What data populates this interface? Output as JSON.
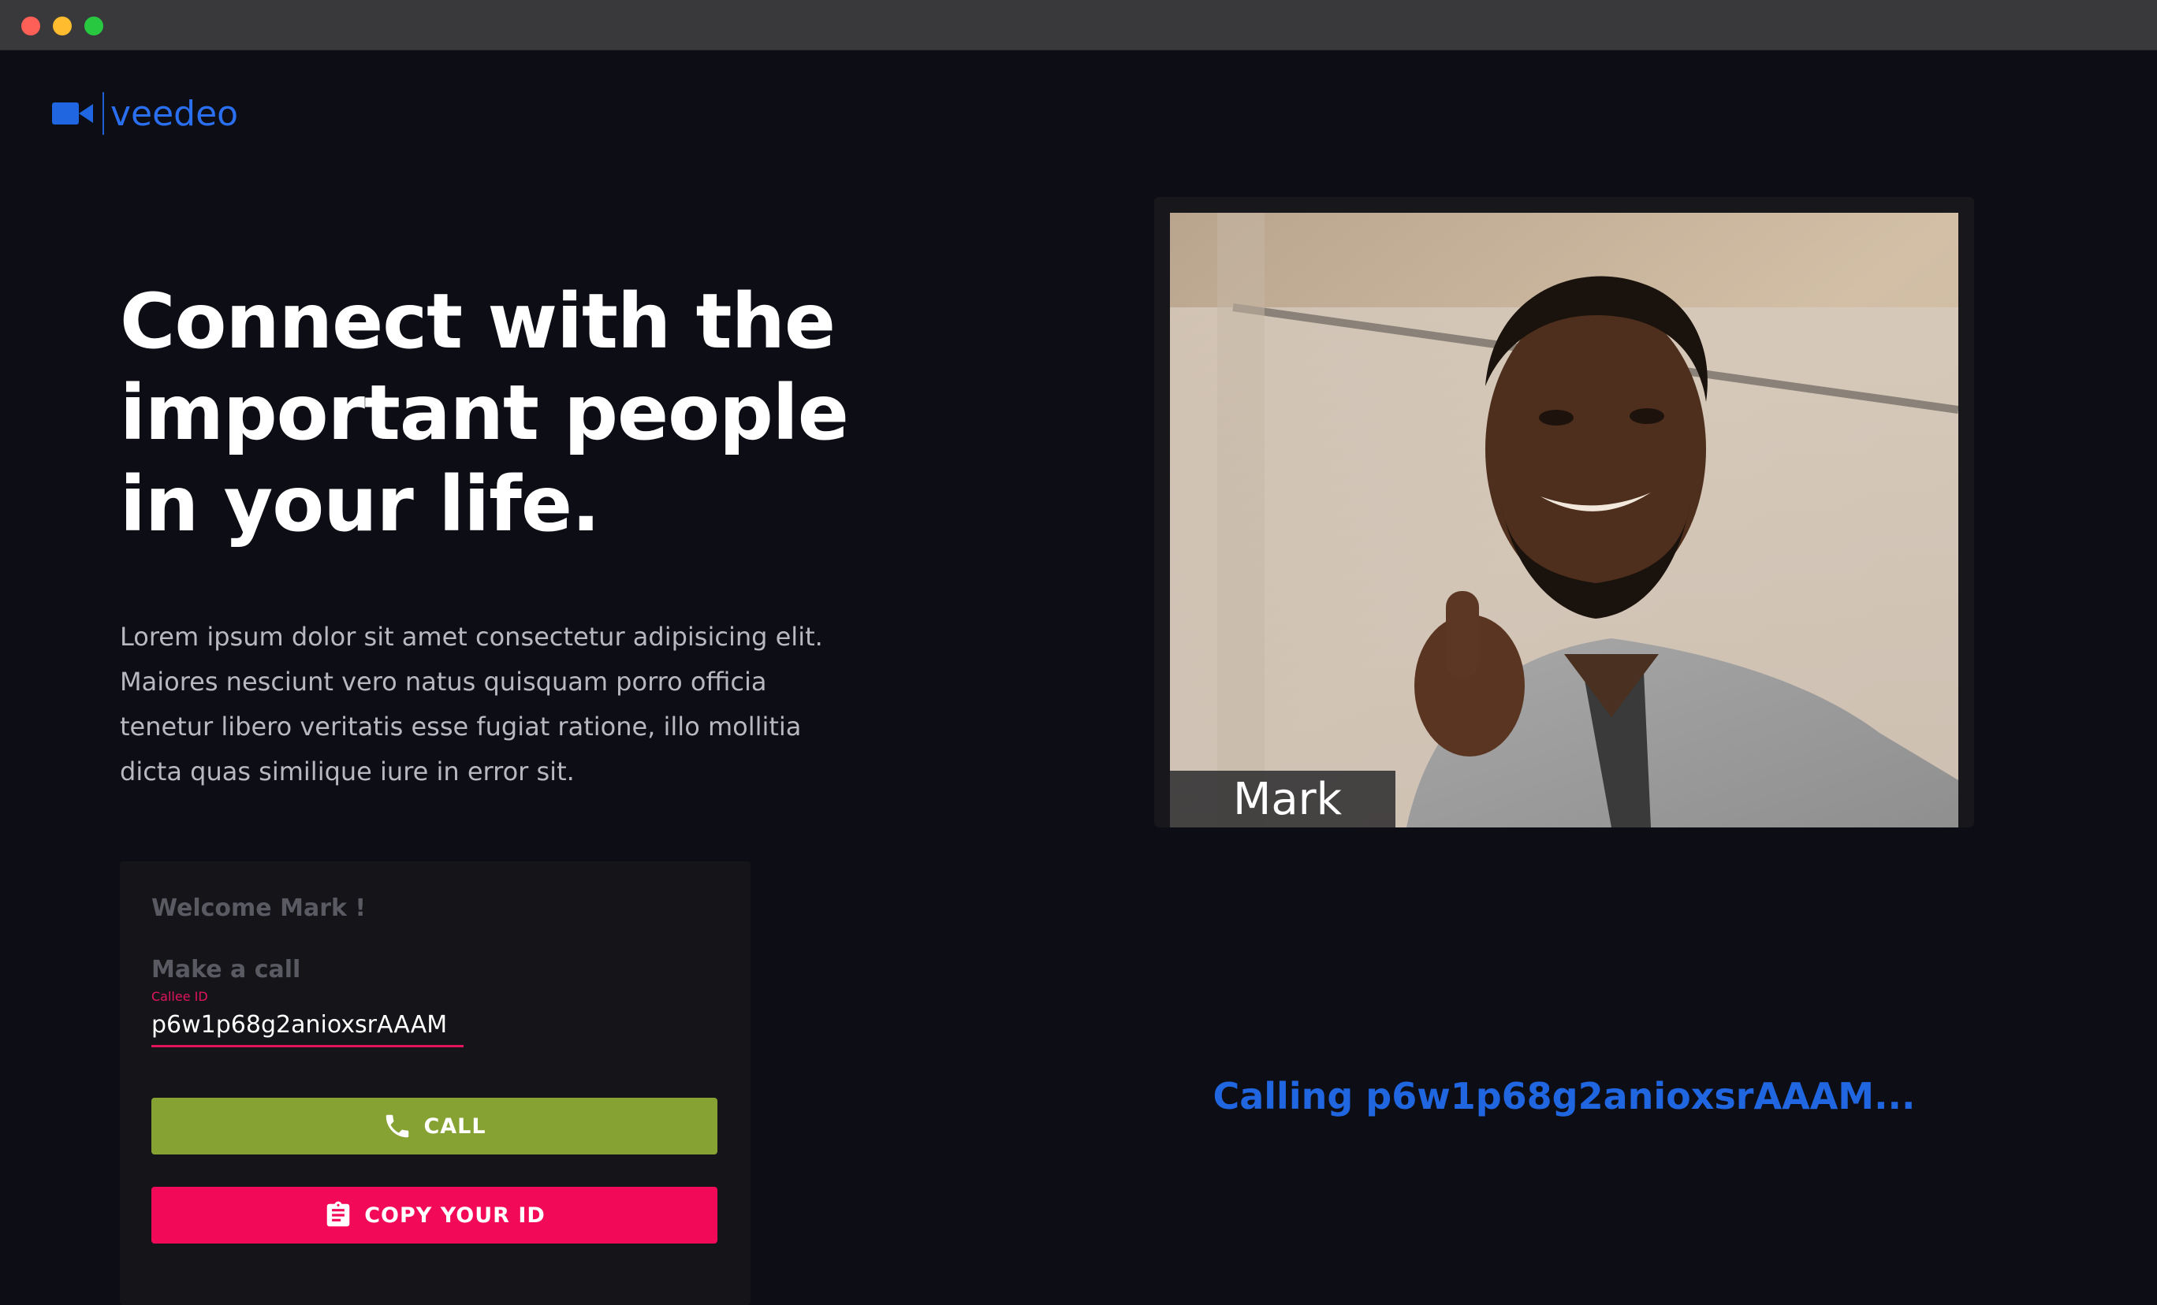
{
  "window": {
    "controls": [
      "close",
      "minimize",
      "maximize"
    ],
    "colors": {
      "close": "#fe5f57",
      "minimize": "#febc2e",
      "maximize": "#28c840"
    }
  },
  "brand": {
    "name": "veedeo",
    "icon": "video-camera-icon",
    "color": "#2a6ff0"
  },
  "hero": {
    "line1": "Connect with the",
    "line2": "important people",
    "line3": "in your life.",
    "lead_line1": "Lorem ipsum dolor sit amet consectetur adipisicing elit.",
    "lead_line2": "Maiores nesciunt vero natus quisquam porro officia",
    "lead_line3": "tenetur libero veritatis esse fugiat ratione, illo mollitia",
    "lead_line4": "dicta quas similique iure in error sit."
  },
  "call_card": {
    "welcome": "Welcome Mark !",
    "make_call": "Make a call",
    "callee_label": "Callee ID",
    "callee_value": "p6w1p68g2anioxsrAAAM",
    "call_button": {
      "label": "CALL",
      "icon": "phone-icon",
      "color": "#86a233"
    },
    "copy_button": {
      "label": "COPY YOUR ID",
      "icon": "clipboard-icon",
      "color": "#f20a59"
    }
  },
  "video": {
    "participant_name": "Mark"
  },
  "status": {
    "calling_text": "Calling p6w1p68g2anioxsrAAAM...",
    "color": "#1f66e0"
  }
}
